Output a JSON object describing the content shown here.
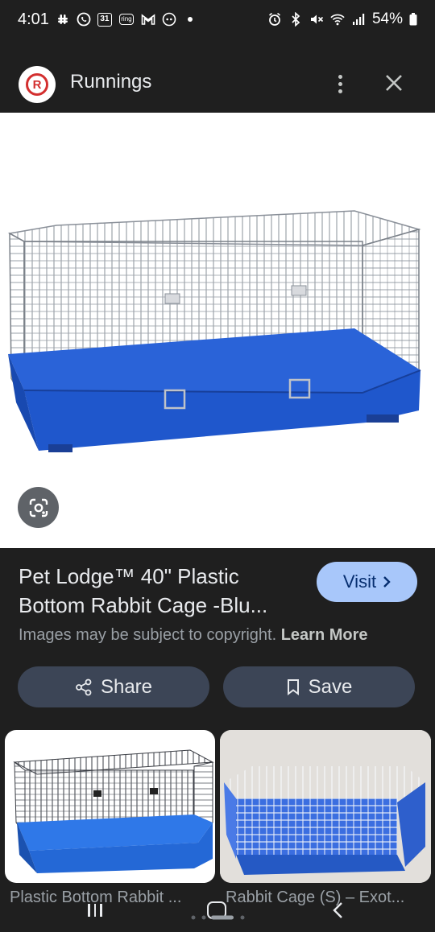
{
  "status_bar": {
    "time": "4:01",
    "calendar_day": "31",
    "ring_label": "ring",
    "battery": "54%"
  },
  "header": {
    "site_name": "Runnings",
    "logo_letter": "R"
  },
  "result": {
    "title": "Pet Lodge™ 40\" Plastic Bottom Rabbit Cage -Blu...",
    "visit_label": "Visit",
    "copyright_text": "Images may be subject to copyright.",
    "learn_more": "Learn More",
    "share_label": "Share",
    "save_label": "Save"
  },
  "related": [
    {
      "label": "Plastic Bottom Rabbit ..."
    },
    {
      "label": "Rabbit Cage (S) – Exot..."
    }
  ],
  "colors": {
    "background": "#1f1f1f",
    "visit_button": "#a8c7fa",
    "action_button": "#3c4556",
    "cage_blue": "#1f5bd6",
    "brand_red": "#d32f2f"
  },
  "icons": [
    "slack-icon",
    "whatsapp-icon",
    "calendar-icon",
    "ring-icon",
    "gmail-icon",
    "alarm-icon",
    "bluetooth-icon",
    "mute-icon",
    "wifi-icon",
    "signal-icon",
    "battery-icon",
    "more-vert-icon",
    "close-icon",
    "lens-icon",
    "share-icon",
    "bookmark-icon",
    "chevron-right-icon"
  ]
}
